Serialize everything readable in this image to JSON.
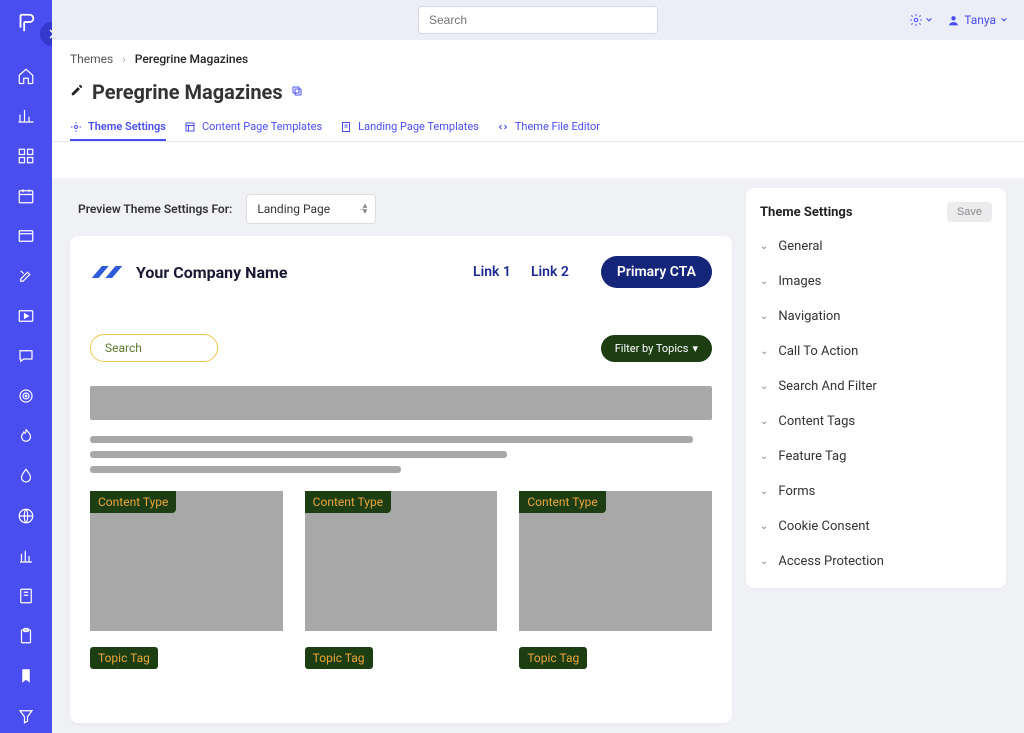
{
  "topbar": {
    "search_placeholder": "Search",
    "username": "Tanya"
  },
  "breadcrumb": {
    "root": "Themes",
    "current": "Peregrine Magazines"
  },
  "page_title": "Peregrine Magazines",
  "tabs": [
    {
      "label": "Theme Settings"
    },
    {
      "label": "Content Page Templates"
    },
    {
      "label": "Landing Page Templates"
    },
    {
      "label": "Theme File Editor"
    }
  ],
  "preview": {
    "label": "Preview Theme Settings For:",
    "selected": "Landing Page"
  },
  "preview_frame": {
    "company_name": "Your Company Name",
    "link1": "Link 1",
    "link2": "Link 2",
    "cta_label": "Primary CTA",
    "search_placeholder": "Search",
    "filter_label": "Filter by Topics",
    "content_type_label": "Content Type",
    "topic_tag_label": "Topic Tag"
  },
  "settings_panel": {
    "title": "Theme Settings",
    "save_label": "Save",
    "sections": [
      "General",
      "Images",
      "Navigation",
      "Call To Action",
      "Search And Filter",
      "Content Tags",
      "Feature Tag",
      "Forms",
      "Cookie Consent",
      "Access Protection"
    ]
  }
}
